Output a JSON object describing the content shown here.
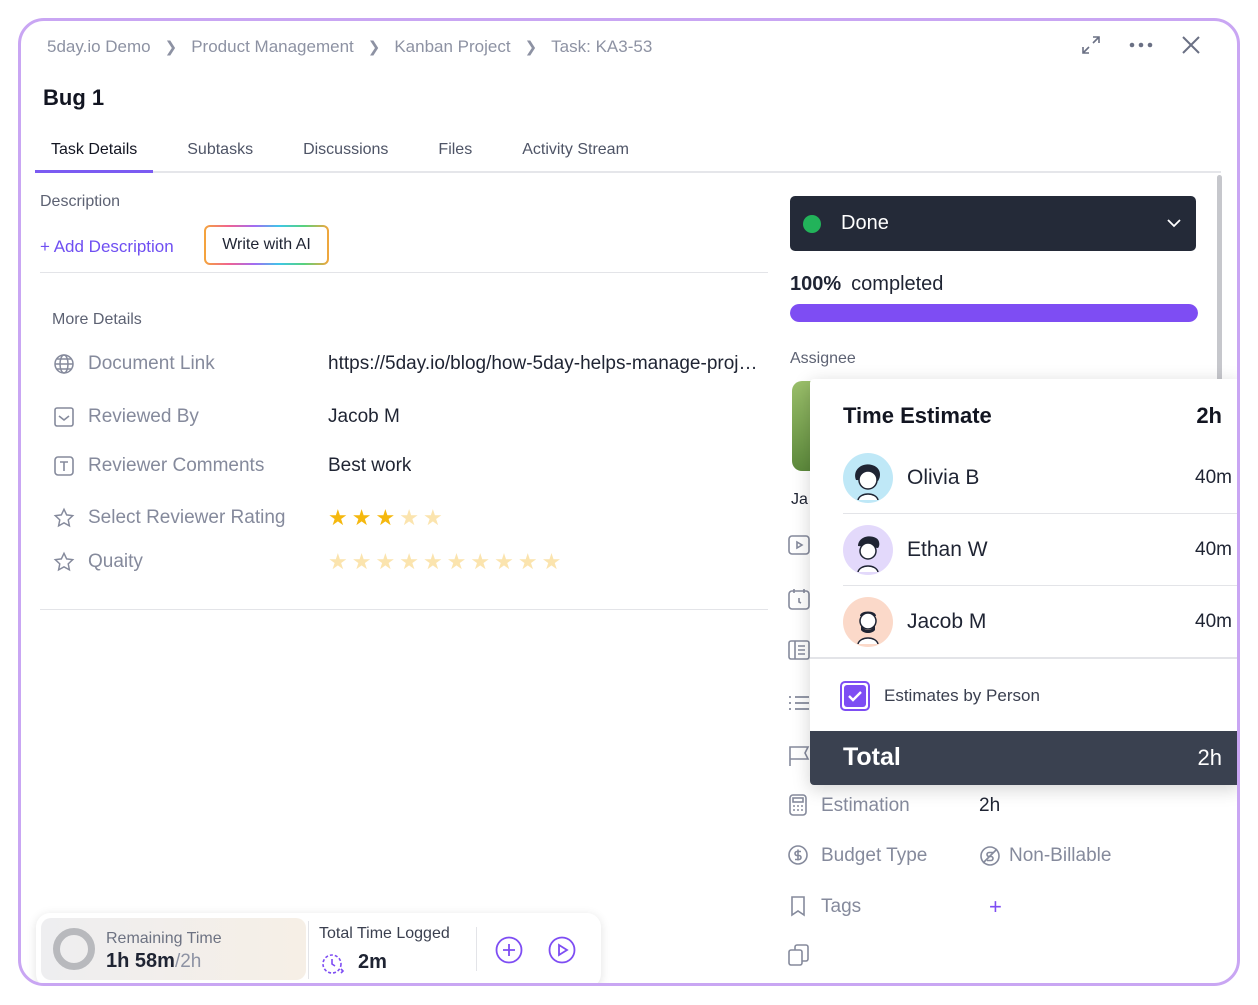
{
  "breadcrumb": [
    "5day.io Demo",
    "Product Management",
    "Kanban Project",
    "Task: KA3-53"
  ],
  "task": {
    "title": "Bug 1"
  },
  "tabs": [
    {
      "label": "Task Details",
      "active": true
    },
    {
      "label": "Subtasks",
      "active": false
    },
    {
      "label": "Discussions",
      "active": false
    },
    {
      "label": "Files",
      "active": false
    },
    {
      "label": "Activity Stream",
      "active": false
    }
  ],
  "description": {
    "label": "Description",
    "add_label": "+ Add Description",
    "ai_label": "Write with AI"
  },
  "more_details": {
    "label": "More Details",
    "fields": [
      {
        "icon": "globe-icon",
        "label": "Document Link",
        "value": "https://5day.io/blog/how-5day-helps-manage-projects"
      },
      {
        "icon": "checkbox-icon",
        "label": "Reviewed By",
        "value": "Jacob M"
      },
      {
        "icon": "text-icon",
        "label": "Reviewer Comments",
        "value": "Best work"
      },
      {
        "icon": "star-outline-icon",
        "label": "Select Reviewer Rating",
        "rating": 3,
        "max": 5
      },
      {
        "icon": "star-outline-icon",
        "label": "Quaity",
        "rating": 0,
        "max": 10
      }
    ]
  },
  "timer": {
    "remaining_label": "Remaining Time",
    "remaining_value": "1h 58m",
    "remaining_total": "/2h",
    "logged_label": "Total Time Logged",
    "logged_value": "2m"
  },
  "status": {
    "label": "Done",
    "color": "#22b35a"
  },
  "progress": {
    "percent_label": "100%",
    "completed_label": "completed",
    "fraction": 1.0,
    "color": "#7e4df3"
  },
  "assignee": {
    "label": "Assignee",
    "peek_text": "Ja"
  },
  "time_estimate": {
    "title": "Time Estimate",
    "total_value": "2h",
    "people": [
      {
        "name": "Olivia B",
        "time": "40m",
        "avatar_bg": "#bfe8f7"
      },
      {
        "name": "Ethan W",
        "time": "40m",
        "avatar_bg": "#e3d9fb"
      },
      {
        "name": "Jacob M",
        "time": "40m",
        "avatar_bg": "#fbd9c9"
      }
    ],
    "checkbox_label": "Estimates by Person",
    "checkbox_checked": true,
    "total_label": "Total",
    "total_bottom": "2h"
  },
  "meta": {
    "estimation": {
      "label": "Estimation",
      "value": "2h"
    },
    "budget_type": {
      "label": "Budget Type",
      "value": "Non-Billable"
    },
    "tags": {
      "label": "Tags",
      "add": "+"
    }
  },
  "colors": {
    "accent": "#7e4df3",
    "frame_border": "#c9a6f3",
    "status_bg": "#242a38"
  }
}
